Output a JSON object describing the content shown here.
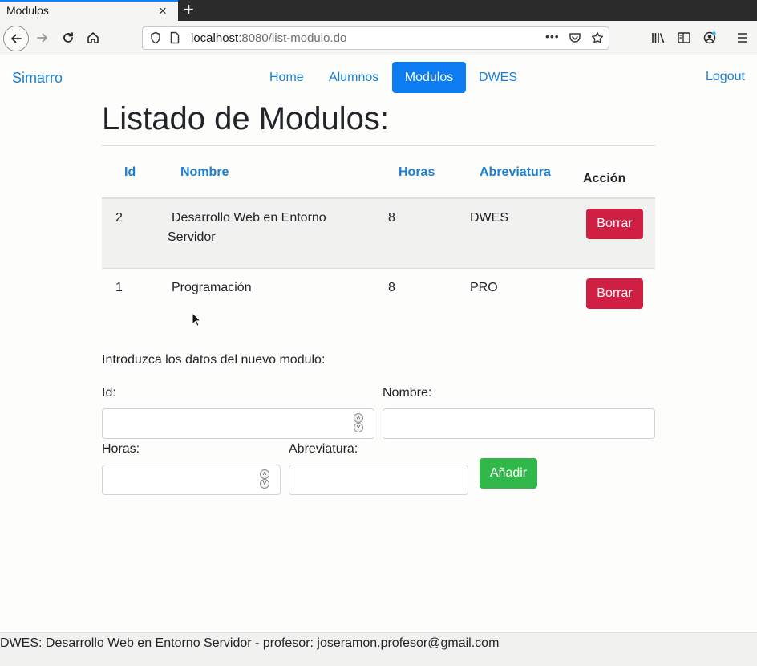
{
  "browser": {
    "tab_title": "Modulos",
    "tab_close": "×",
    "new_tab": "+",
    "url_host": "localhost",
    "url_rest": ":8080/list-modulo.do"
  },
  "nav": {
    "brand": "Simarro",
    "links": [
      "Home",
      "Alumnos",
      "Modulos",
      "DWES"
    ],
    "active": "Modulos",
    "logout": "Logout"
  },
  "page": {
    "title": "Listado de Modulos:"
  },
  "table": {
    "headers": [
      "Id",
      "Nombre",
      "Horas",
      "Abreviatura",
      "Acción"
    ],
    "rows": [
      {
        "id": "2",
        "nombre_line1": "Desarrollo Web en Entorno",
        "nombre_line2": "Servidor",
        "horas": "8",
        "abreviatura": "DWES",
        "action": "Borrar"
      },
      {
        "id": "1",
        "nombre_line1": "Programación",
        "nombre_line2": "",
        "horas": "8",
        "abreviatura": "PRO",
        "action": "Borrar"
      }
    ]
  },
  "form": {
    "intro": "Introduzca los datos del nuevo modulo:",
    "id_label": "Id:",
    "nombre_label": "Nombre:",
    "horas_label": "Horas:",
    "abreviatura_label": "Abreviatura:",
    "id_value": "",
    "nombre_value": "",
    "horas_value": "",
    "abreviatura_value": "",
    "submit": "Añadir"
  },
  "footer": {
    "text": "DWES: Desarrollo Web en Entorno Servidor - profesor: joseramon.profesor@gmail.com"
  },
  "colors": {
    "link": "#1a7fd9",
    "active_nav": "#0d7cf2",
    "danger": "#cf2043",
    "success": "#31b84a"
  }
}
